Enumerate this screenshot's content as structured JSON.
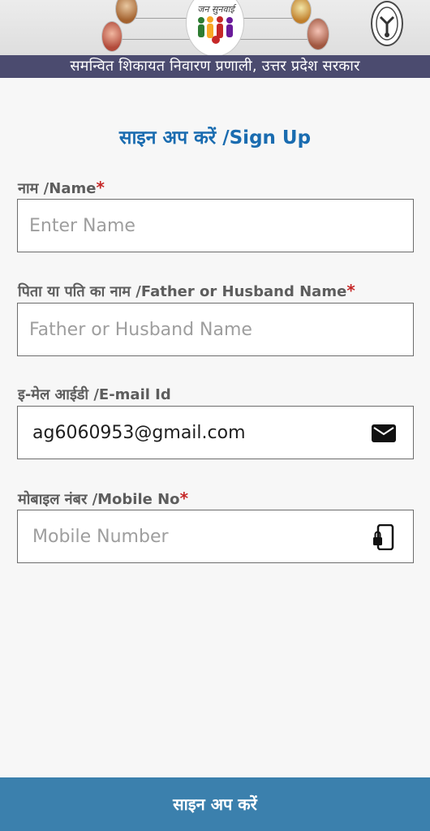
{
  "header": {
    "logo_text": "जन सुनवाई",
    "portal_title": "समन्वित शिकायत निवारण प्रणाली, उत्तर प्रदेश सरकार"
  },
  "form": {
    "title": "साइन अप करें /Sign Up",
    "fields": [
      {
        "label": "नाम /Name",
        "required": true,
        "value": "",
        "placeholder": "Enter Name",
        "icon": ""
      },
      {
        "label": "पिता या पति का नाम /Father or Husband Name",
        "required": true,
        "value": "",
        "placeholder": "Father or Husband Name",
        "icon": ""
      },
      {
        "label": "इ-मेल आईडी /E-mail Id",
        "required": false,
        "value": "ag6060953@gmail.com",
        "placeholder": "",
        "icon": "mail-icon"
      },
      {
        "label": "मोबाइल नंबर /Mobile  No",
        "required": true,
        "value": "",
        "placeholder": "Mobile Number",
        "icon": "phone-lock-icon"
      }
    ],
    "required_marker": "*",
    "submit_label": "साइन अप करें"
  },
  "colors": {
    "title_blue": "#1a6cb0",
    "required_red": "#c62828",
    "govt_bar": "#4b4b6f",
    "button": "#3b80ad"
  }
}
